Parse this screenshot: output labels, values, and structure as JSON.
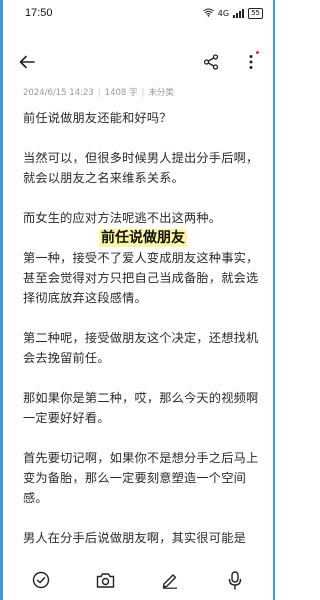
{
  "status_bar": {
    "time": "17:50",
    "network": "4G",
    "battery": "55"
  },
  "toolbar": {
    "icons": [
      "back-arrow-icon",
      "share-icon",
      "more-icon"
    ]
  },
  "meta": {
    "date": "2024/6/15 14:23",
    "word_count": "1408 字",
    "category": "未分类"
  },
  "note": {
    "paragraphs": [
      "前任说做朋友还能和好吗？",
      "当然可以，但很多时候男人提出分手后啊，就会以朋友之名来维系关系。",
      "而女生的应对方法呢逃不出这两种。"
    ],
    "heading": "前任说做朋友",
    "paragraphs_after": [
      "第一种，接受不了爱人变成朋友这种事实，甚至会觉得对方只把自己当成备胎，就会选择彻底放弃这段感情。",
      "第二种呢，接受做朋友这个决定，还想找机会去挽留前任。",
      "那如果你是第二种，哎，那么今天的视频啊一定要好好看。",
      "首先要切记啊，如果你不是想分手之后马上变为备胎，那么一定要刻意塑造一个空间感。",
      "男人在分手后说做朋友啊，其实很可能是"
    ]
  },
  "bottom_bar": {
    "icons": [
      "checklist-icon",
      "camera-icon",
      "pen-icon",
      "microphone-icon"
    ]
  },
  "colors": {
    "highlight": "#fdf6a6",
    "border": "#3b9be0",
    "meta": "#999999"
  }
}
